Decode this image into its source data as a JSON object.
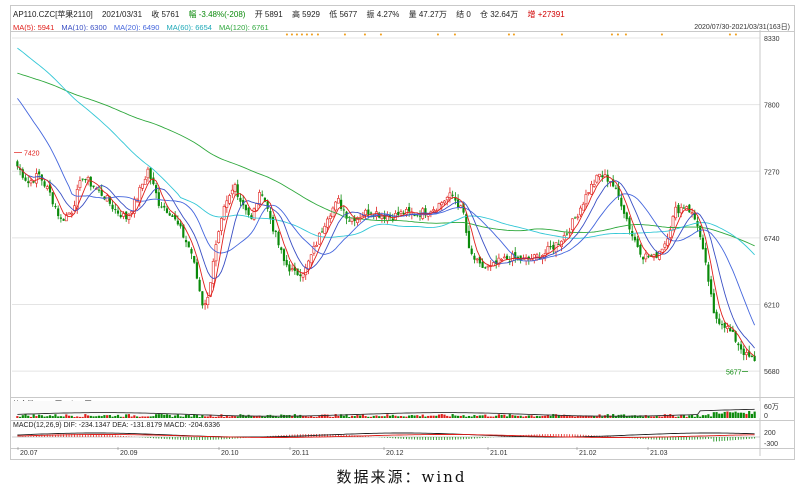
{
  "header": {
    "symbol": "AP110.CZC[苹果2110]",
    "date": "2021/03/31",
    "close": "收 5761",
    "change": "幅 -3.48%(-208)",
    "open": "开 5891",
    "high": "高 5929",
    "low": "低 5677",
    "amplitude": "振 4.27%",
    "volume": "量 47.27万",
    "settle": "结 0",
    "oi": "仓 32.64万",
    "oi_change": "增 +27391"
  },
  "ma_legend": [
    {
      "label": "MA(5): 5941",
      "color": "#e0201c"
    },
    {
      "label": "MA(10): 6300",
      "color": "#3a4fc4"
    },
    {
      "label": "MA(20): 6490",
      "color": "#4466dd"
    },
    {
      "label": "MA(60): 6654",
      "color": "#33c7d6"
    },
    {
      "label": "MA(120): 6761",
      "color": "#2ea83c"
    }
  ],
  "date_range": "2020/07/30-2021/03/31(163日)",
  "indicators": {
    "oi_label": "持仓量 OI: 33万 vol: 47万",
    "oi_axis_top": "60万",
    "oi_axis_bottom": "0",
    "macd_label": "MACD(12,26,9) DIF: -234.1347 DEA: -131.8179 MACD: -204.6336",
    "macd_axis_top": "200",
    "macd_axis_bottom": "-300"
  },
  "caption": "数据来源：wind",
  "chart_data": {
    "type": "candlestick",
    "y_ticks": [
      8330,
      7800,
      7270,
      6740,
      6210,
      5680
    ],
    "y_range": [
      5570,
      8370
    ],
    "x_ticks": [
      "20.07",
      "20.09",
      "20.10",
      "20.11",
      "20.12",
      "21.01",
      "21.02",
      "21.03"
    ],
    "annotations": {
      "high_label": "7420",
      "low_label": "5677"
    },
    "colors": {
      "up": "#e0201c",
      "down": "#0a8a0a",
      "grid": "#e4e4e4"
    }
  }
}
